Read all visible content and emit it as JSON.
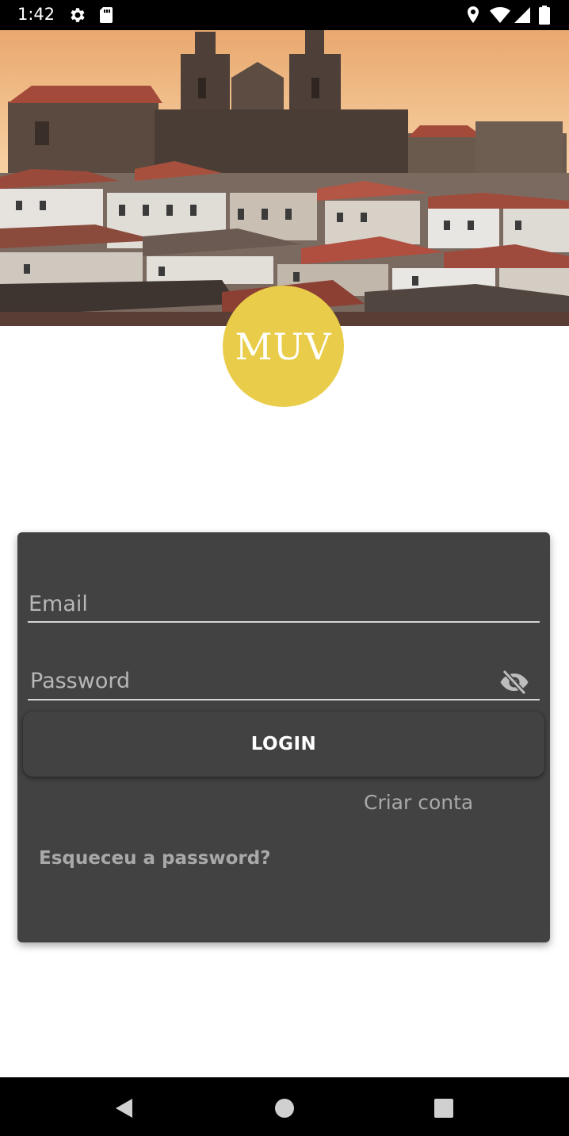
{
  "status_bar": {
    "time": "1:42",
    "icons_left": [
      "gear-icon",
      "sd-card-icon"
    ],
    "icons_right": [
      "location-pin-icon",
      "wifi-icon",
      "cell-signal-icon",
      "battery-icon"
    ]
  },
  "hero": {
    "description_icon": "city-photo",
    "logo_text": "MUV",
    "logo_color": "#e9cd4a"
  },
  "login_form": {
    "email_placeholder": "Email",
    "email_value": "",
    "password_placeholder": "Password",
    "password_value": "",
    "password_toggle_icon": "eye-off-icon",
    "login_label": "LOGIN",
    "create_account_label": "Criar conta",
    "forgot_password_label": "Esqueceu a password?",
    "card_color": "#424242"
  },
  "nav_bar": {
    "back_icon": "back-triangle-icon",
    "home_icon": "home-circle-icon",
    "recents_icon": "recents-square-icon"
  }
}
